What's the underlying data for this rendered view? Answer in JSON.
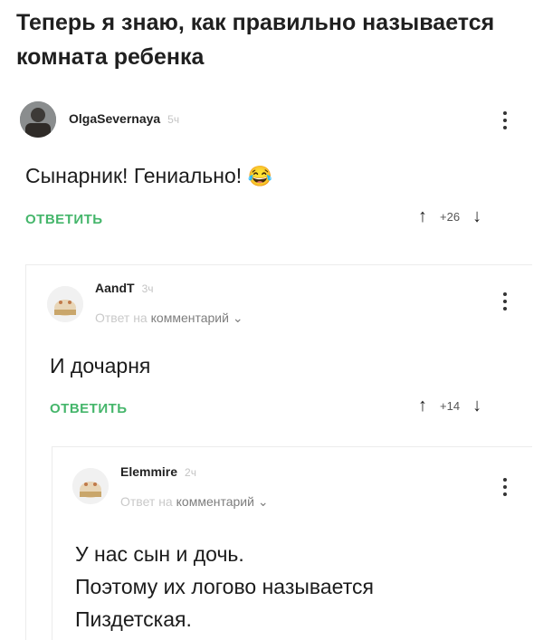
{
  "title": "Теперь я знаю, как правильно называется комната ребенка",
  "comments": [
    {
      "author": "OlgaSevernaya",
      "time": "5ч",
      "text": "Сынарник! Гениально!",
      "emoji": "😂",
      "reply_label": "ОТВЕТИТЬ",
      "votes": "+26"
    },
    {
      "author": "AandT",
      "time": "3ч",
      "reply_to_prefix": "Ответ на",
      "reply_to_link": "комментарий",
      "text": "И дочарня",
      "reply_label": "ОТВЕТИТЬ",
      "votes": "+14"
    },
    {
      "author": "Elemmire",
      "time": "2ч",
      "reply_to_prefix": "Ответ на",
      "reply_to_link": "комментарий",
      "text_lines": [
        "У нас сын и дочь.",
        "Поэтому их логово называется",
        "Пиздетская."
      ]
    }
  ],
  "icons": {
    "upvote": "↑",
    "downvote": "↓",
    "chevron": "⌄",
    "avatar_2": "cat-avatar-icon",
    "avatar_3": "cat-avatar-icon"
  },
  "colors": {
    "accent": "#45b66b",
    "muted": "#c4c4c4"
  }
}
